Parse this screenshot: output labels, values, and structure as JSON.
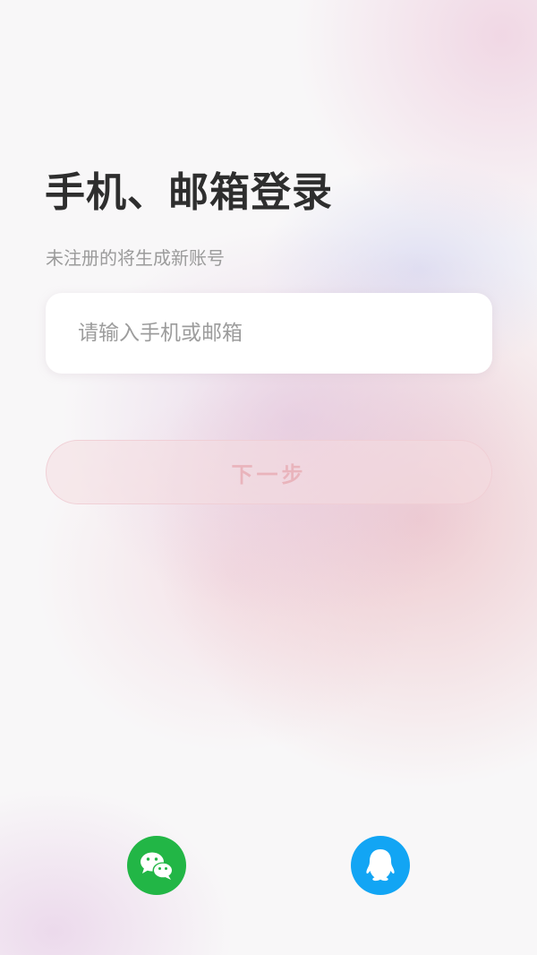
{
  "login": {
    "title": "手机、邮箱登录",
    "subtitle": "未注册的将生成新账号",
    "account_input": {
      "value": "",
      "placeholder": "请输入手机或邮箱"
    },
    "next_button": {
      "label": "下一步",
      "state": "disabled"
    }
  },
  "social_login": {
    "wechat": {
      "icon": "wechat-icon",
      "color": "#22b646"
    },
    "qq": {
      "icon": "qq-icon",
      "color": "#12a5f4"
    }
  },
  "colors": {
    "title": "#2e2e2e",
    "subtitle": "#9b9b9b",
    "next_label_disabled": "#e9b4bc"
  }
}
